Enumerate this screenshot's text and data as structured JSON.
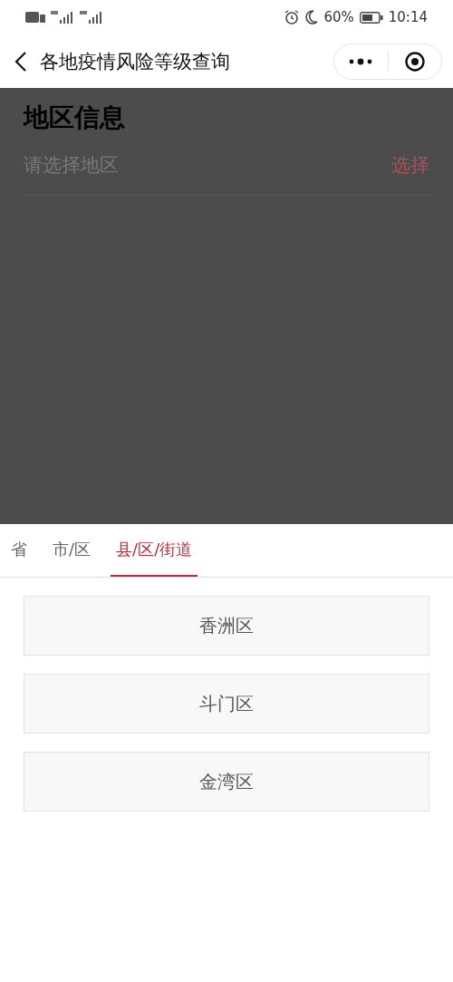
{
  "status_bar": {
    "battery": "60%",
    "time": "10:14"
  },
  "nav": {
    "title": "各地疫情风险等级查询"
  },
  "region_info": {
    "title": "地区信息",
    "placeholder": "请选择地区",
    "action": "选择"
  },
  "sheet": {
    "tabs": [
      {
        "label": "省",
        "selected": false
      },
      {
        "label": "市/区",
        "selected": false
      },
      {
        "label": "县/区/街道",
        "selected": true
      }
    ],
    "options": [
      "香洲区",
      "斗门区",
      "金湾区"
    ]
  }
}
